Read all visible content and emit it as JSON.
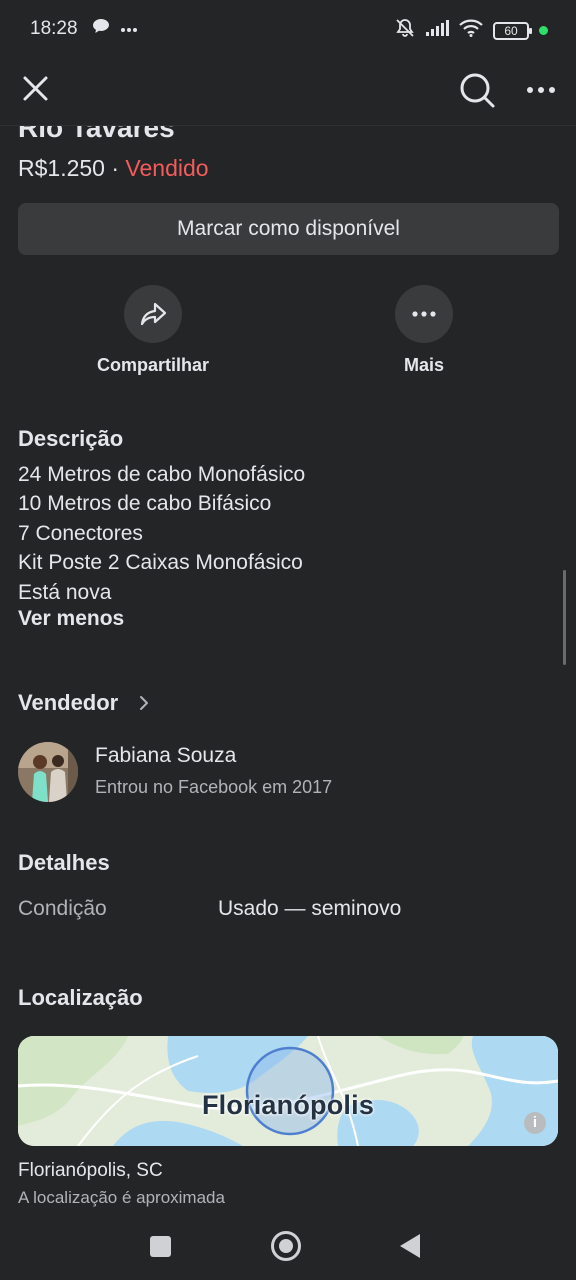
{
  "status_bar": {
    "time": "18:28",
    "battery": "60",
    "icons": [
      "chat-bubble-icon",
      "more-dots-icon",
      "mute-icon",
      "signal-icon",
      "wifi-icon",
      "battery-icon"
    ],
    "dot_color": "#2ee06a"
  },
  "listing": {
    "title": "Rio Tavares",
    "price": "R$1.250",
    "separator": " · ",
    "status": "Vendido",
    "status_color": "#f25c5c"
  },
  "actions": {
    "mark_available": "Marcar como disponível",
    "share": "Compartilhar",
    "more": "Mais"
  },
  "description": {
    "heading": "Descrição",
    "lines": [
      "24 Metros de cabo Monofásico",
      "10 Metros de cabo Bifásico",
      "7 Conectores",
      "Kit Poste 2 Caixas Monofásico",
      "Está nova"
    ],
    "toggle": "Ver menos"
  },
  "seller": {
    "heading": "Vendedor",
    "name": "Fabiana Souza",
    "joined": "Entrou no Facebook em 2017"
  },
  "details": {
    "heading": "Detalhes",
    "rows": [
      {
        "key": "Condição",
        "value": "Usado — seminovo"
      }
    ]
  },
  "location": {
    "heading": "Localização",
    "map_label": "Florianópolis",
    "city": "Florianópolis, SC",
    "note": "A localização é aproximada",
    "info_glyph": "i"
  },
  "colors": {
    "background": "#242526",
    "surface": "#3a3b3c",
    "text_primary": "#e4e6eb",
    "text_secondary": "#b0b3b8"
  }
}
